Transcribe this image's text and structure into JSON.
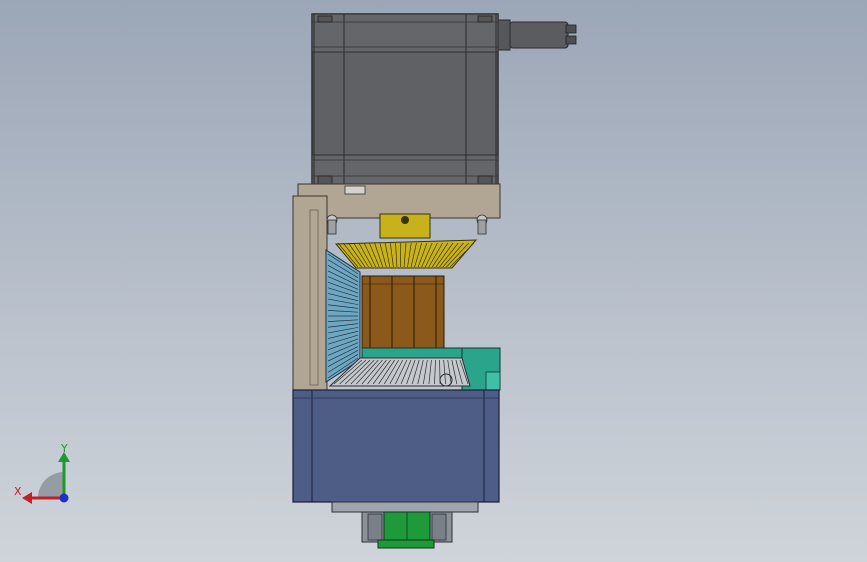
{
  "viewport": {
    "background_top": "#9ba6b7",
    "background_bottom": "#cfd4da"
  },
  "model": {
    "parts": [
      {
        "name": "stepper-motor",
        "color": "#5f6165"
      },
      {
        "name": "motor-connector",
        "color": "#5a5c60"
      },
      {
        "name": "mounting-bracket",
        "color": "#b1a594"
      },
      {
        "name": "upper-bevel-gear",
        "color": "#c9b31a"
      },
      {
        "name": "input-shaft-coupling",
        "color": "#c8b21c"
      },
      {
        "name": "side-bevel-gear",
        "color": "#6fa6c2"
      },
      {
        "name": "gear-core-block",
        "color": "#8b5a1a"
      },
      {
        "name": "lower-bevel-gear",
        "color": "#c5c8cc"
      },
      {
        "name": "teal-bearing-housing",
        "color": "#2aa58c"
      },
      {
        "name": "gearbox-housing",
        "color": "#4d5d86"
      },
      {
        "name": "base-plate",
        "color": "#9ea4ac"
      },
      {
        "name": "output-shaft",
        "color": "#1f9a3a"
      }
    ]
  },
  "triad": {
    "x_label": "X",
    "y_label": "Y",
    "x_color": "#c0202a",
    "y_color": "#1a9a2a",
    "z_color": "#2030c0"
  }
}
